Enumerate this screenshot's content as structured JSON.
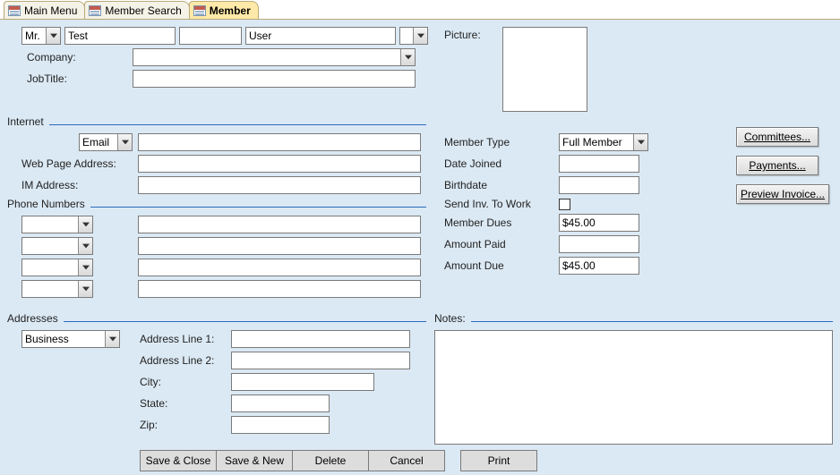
{
  "tabs": {
    "t0": "Main Menu",
    "t1": "Member Search",
    "t2": "Member"
  },
  "name": {
    "title": "Mr.",
    "first": "Test",
    "middle": "",
    "last": "User",
    "suffix": ""
  },
  "company_label": "Company:",
  "company_value": "",
  "jobtitle_label": "JobTitle:",
  "jobtitle_value": "",
  "internet": {
    "section": "Internet",
    "email_label": "Email",
    "email_value": "",
    "web_label": "Web Page Address:",
    "web_value": "",
    "im_label": "IM Address:",
    "im_value": ""
  },
  "phones": {
    "section": "Phone Numbers"
  },
  "addresses": {
    "section": "Addresses",
    "type": "Business",
    "l1_label": "Address Line 1:",
    "l1": "",
    "l2_label": "Address Line 2:",
    "l2": "",
    "city_label": "City:",
    "city": "",
    "state_label": "State:",
    "state": "",
    "zip_label": "Zip:",
    "zip": ""
  },
  "picture_label": "Picture:",
  "member": {
    "type_label": "Member Type",
    "type_value": "Full Member",
    "joined_label": "Date Joined",
    "joined_value": "",
    "birth_label": "Birthdate",
    "birth_value": "",
    "sendinv_label": "Send Inv. To Work",
    "dues_label": "Member Dues",
    "dues_value": "$45.00",
    "paid_label": "Amount Paid",
    "paid_value": "",
    "due_label": "Amount Due",
    "due_value": "$45.00"
  },
  "notes_label": "Notes:",
  "buttons": {
    "committees": "Committees...",
    "payments": "Payments...",
    "preview": "Preview Invoice...",
    "saveclose": "Save & Close",
    "savenew": "Save & New",
    "delete": "Delete",
    "cancel": "Cancel",
    "print": "Print"
  }
}
